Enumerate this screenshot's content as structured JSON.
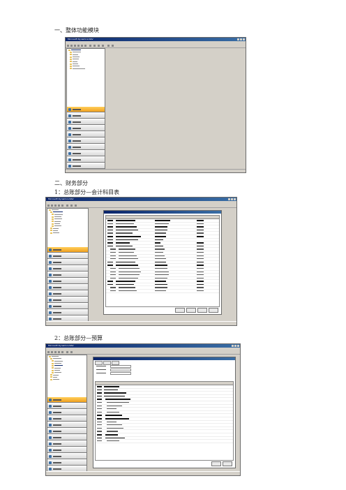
{
  "sections": {
    "s1": "一、整体功能模块",
    "s2": "二、财务部分",
    "s3": "1：总账部分—会计科目表",
    "s4": "2：总账部分—预算"
  },
  "screenshots": {
    "overview": {
      "title": "Microsoft Dynamics NAV"
    },
    "coa": {
      "title": "Microsoft Dynamics NAV"
    },
    "budget": {
      "title": "Microsoft Dynamics NAV"
    }
  },
  "colors": {
    "accent_orange": "#f0a020",
    "title_blue": "#0a246a"
  }
}
